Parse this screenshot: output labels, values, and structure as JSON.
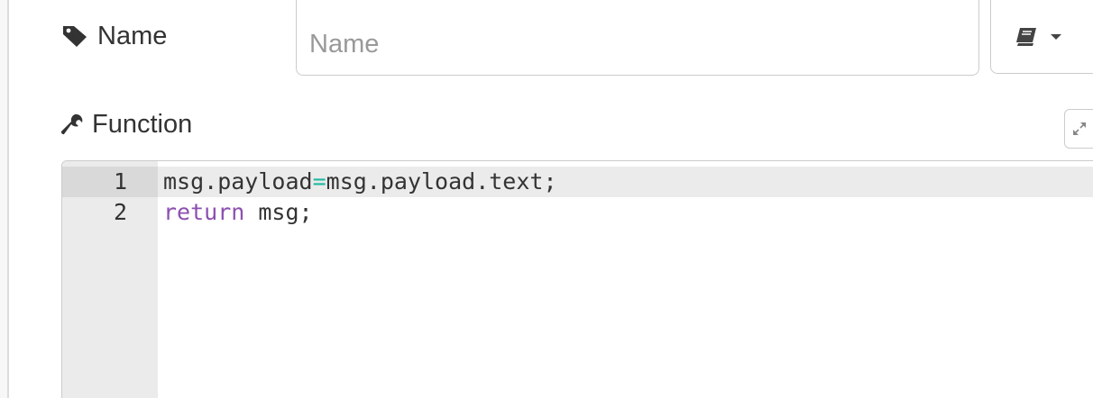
{
  "name_field": {
    "label": "Name",
    "placeholder": "Name",
    "value": ""
  },
  "icon_selector": {
    "icon": "book-icon"
  },
  "function_section": {
    "label": "Function",
    "expand_icon": "expand-icon"
  },
  "editor": {
    "lines": [
      {
        "number": "1",
        "segments": [
          {
            "text": "msg.payload",
            "kind": "plain"
          },
          {
            "text": "=",
            "kind": "operator"
          },
          {
            "text": "msg.payload.text;",
            "kind": "plain"
          }
        ]
      },
      {
        "number": "2",
        "segments": [
          {
            "text": "return",
            "kind": "keyword"
          },
          {
            "text": " msg;",
            "kind": "plain"
          }
        ]
      }
    ]
  },
  "colors": {
    "keyword": "#8c4fb0",
    "operator": "#1eb9a0",
    "gutter": "#ebebeb"
  }
}
